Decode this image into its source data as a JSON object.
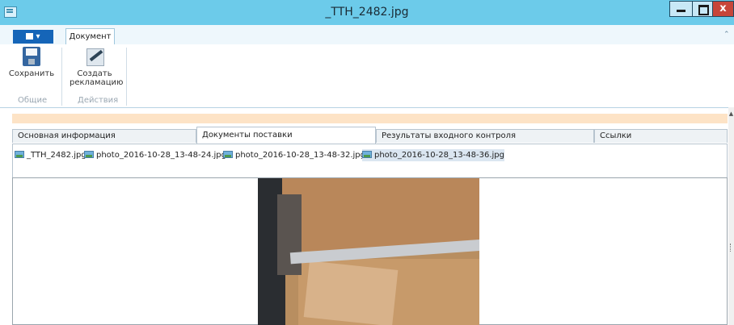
{
  "window": {
    "title": "_TTH_2482.jpg",
    "close_glyph": "x"
  },
  "ribbon": {
    "tab_document": "Документ",
    "buttons": {
      "save": "Сохранить",
      "create_claim_line1": "Создать",
      "create_claim_line2": "рекламацию"
    },
    "groups": {
      "general": "Общие",
      "actions": "Действия"
    }
  },
  "content_tabs": [
    "Основная информация",
    "Документы поставки",
    "Результаты входного контроля",
    "Ссылки"
  ],
  "active_tab_index": 1,
  "files": [
    "_TTH_2482.jpg",
    "photo_2016-10-28_13-48-24.jpg",
    "photo_2016-10-28_13-48-32.jpg",
    "photo_2016-10-28_13-48-36.jpg"
  ],
  "selected_file_index": 3,
  "icons": {
    "app": "app-window-icon",
    "save": "floppy-disk-icon",
    "create": "pencil-document-icon",
    "file": "image-file-icon",
    "collapse": "chevron-up-icon"
  },
  "colors": {
    "titlebar": "#6ccbea",
    "file_button": "#1565b8",
    "close_button": "#c7463a",
    "notification_bar": "#fde3c6",
    "selected_file": "#dbe6f1"
  }
}
